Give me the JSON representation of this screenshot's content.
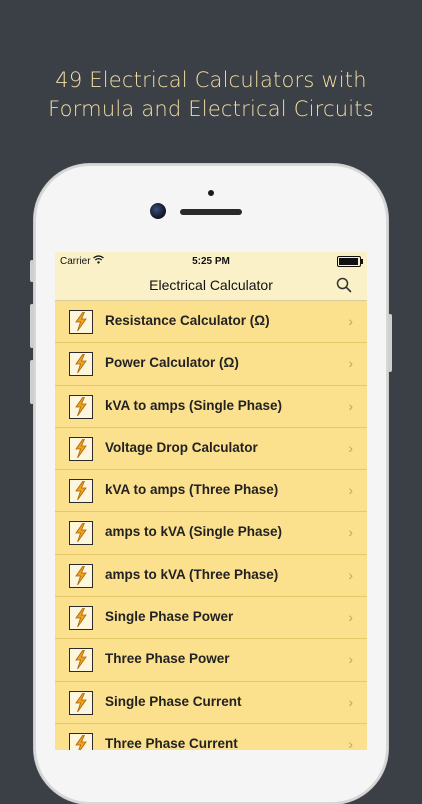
{
  "headline": {
    "line1": "49 Electrical Calculators with",
    "line2": "Formula and Electrical Circuits"
  },
  "status_bar": {
    "carrier": "Carrier",
    "time": "5:25 PM",
    "battery_level": 1.0
  },
  "nav": {
    "title": "Electrical Calculator",
    "search_icon": "search-icon"
  },
  "calculators": [
    {
      "label": "Resistance Calculator (Ω)"
    },
    {
      "label": "Power Calculator (Ω)"
    },
    {
      "label": "kVA to amps (Single Phase)"
    },
    {
      "label": "Voltage Drop Calculator"
    },
    {
      "label": "kVA to amps (Three Phase)"
    },
    {
      "label": "amps to kVA (Single Phase)"
    },
    {
      "label": "amps to kVA (Three Phase)"
    },
    {
      "label": "Single Phase Power"
    },
    {
      "label": "Three Phase Power"
    },
    {
      "label": "Single Phase Current"
    },
    {
      "label": "Three Phase Current"
    }
  ],
  "row_icon": "lightning-icon",
  "chevron_glyph": "›",
  "colors": {
    "background": "#3b3f46",
    "headline": "#f3dfa4",
    "bar": "#fbf1c8",
    "row": "#fbe08d",
    "bolt": "#f0a21d"
  }
}
